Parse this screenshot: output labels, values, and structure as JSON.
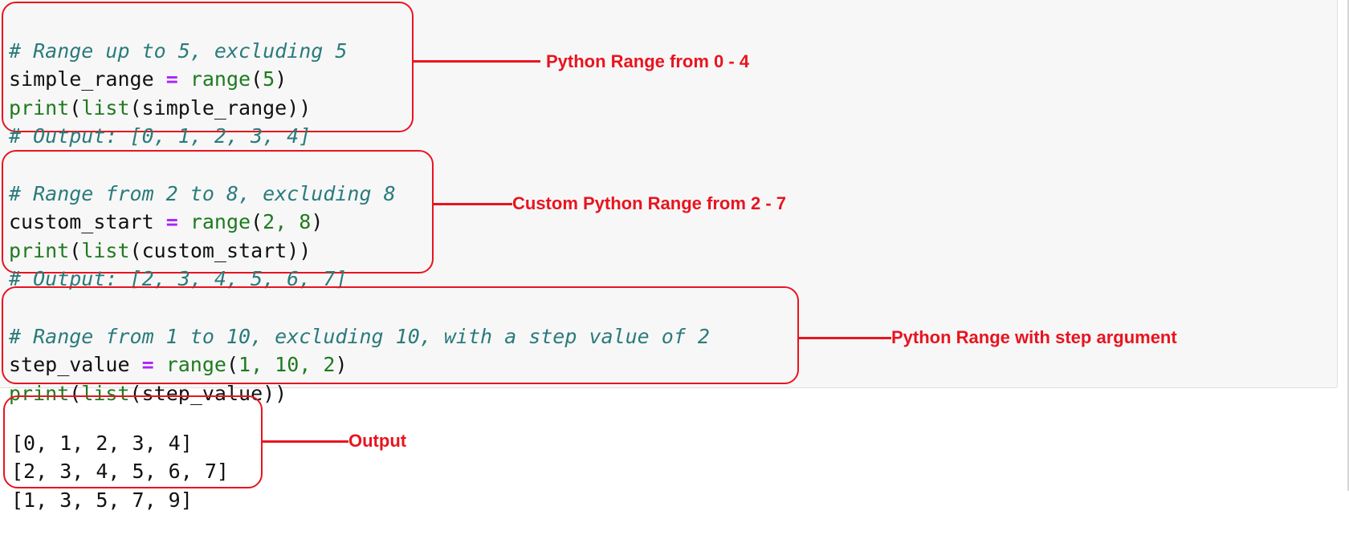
{
  "cells": [
    {
      "comment": "# Range up to 5, excluding 5",
      "assign_var": "simple_range",
      "assign_op": "=",
      "assign_fn": "range",
      "assign_args": "5",
      "print_fn": "print",
      "list_fn": "list",
      "print_arg": "simple_range",
      "output_comment": "# Output: [0, 1, 2, 3, 4]",
      "annotation": "Python Range from 0 - 4"
    },
    {
      "comment": "# Range from 2 to 8, excluding 8",
      "assign_var": "custom_start",
      "assign_op": "=",
      "assign_fn": "range",
      "assign_args": "2, 8",
      "print_fn": "print",
      "list_fn": "list",
      "print_arg": "custom_start",
      "output_comment": "# Output: [2, 3, 4, 5, 6, 7]",
      "annotation": "Custom Python Range from 2 - 7"
    },
    {
      "comment": "# Range from 1 to 10, excluding 10, with a step value of 2",
      "assign_var": "step_value",
      "assign_op": "=",
      "assign_fn": "range",
      "assign_args": "1, 10, 2",
      "print_fn": "print",
      "list_fn": "list",
      "print_arg": "step_value",
      "annotation": "Python Range with step argument"
    }
  ],
  "output": {
    "lines": [
      "[0, 1, 2, 3, 4]",
      "[2, 3, 4, 5, 6, 7]",
      "[1, 3, 5, 7, 9]"
    ],
    "annotation": "Output"
  },
  "colors": {
    "annotation": "#e8141f",
    "comment": "#2a7b7b",
    "builtin": "#1f7a1f",
    "operator": "#aa22ff",
    "cell_background": "#f7f7f7"
  }
}
